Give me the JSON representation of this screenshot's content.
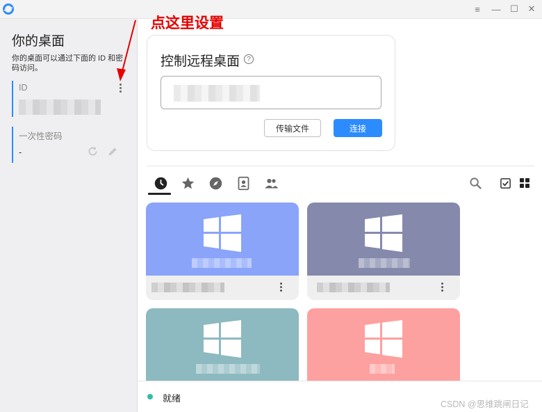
{
  "window": {
    "minimize_glyph": "—",
    "maximize_glyph": "☐",
    "close_glyph": "✕",
    "menu_glyph": "≡"
  },
  "left": {
    "title": "你的桌面",
    "description": "你的桌面可以通过下面的 ID 和密码访问。",
    "id_label": "ID",
    "id_value": "",
    "password_label": "一次性密码",
    "password_value": "-"
  },
  "annotation": {
    "text": "点这里设置",
    "color": "#e60000"
  },
  "control": {
    "title": "控制远程桌面",
    "help_glyph": "?",
    "input_value": "",
    "transfer_button": "传输文件",
    "connect_button": "连接"
  },
  "tabs": [
    {
      "icon": "recent-clock-icon",
      "active": true
    },
    {
      "icon": "favorites-star-icon",
      "active": false
    },
    {
      "icon": "discover-compass-icon",
      "active": false
    },
    {
      "icon": "address-book-icon",
      "active": false
    },
    {
      "icon": "group-people-icon",
      "active": false
    }
  ],
  "tools": [
    "search-icon",
    "select-checkbox-icon",
    "grid-view-icon"
  ],
  "peers": [
    {
      "color": "#8aa4fa",
      "os": "windows-icon"
    },
    {
      "color": "#8589ac",
      "os": "windows-icon"
    },
    {
      "color": "#8db9c0",
      "os": "windows-icon"
    },
    {
      "color": "#fda1a0",
      "os": "windows-icon"
    }
  ],
  "status": {
    "text": "就绪",
    "color": "#32bea6"
  },
  "watermark": "CSDN @思维跳闸日记",
  "colors": {
    "accent": "#2c8cff"
  }
}
